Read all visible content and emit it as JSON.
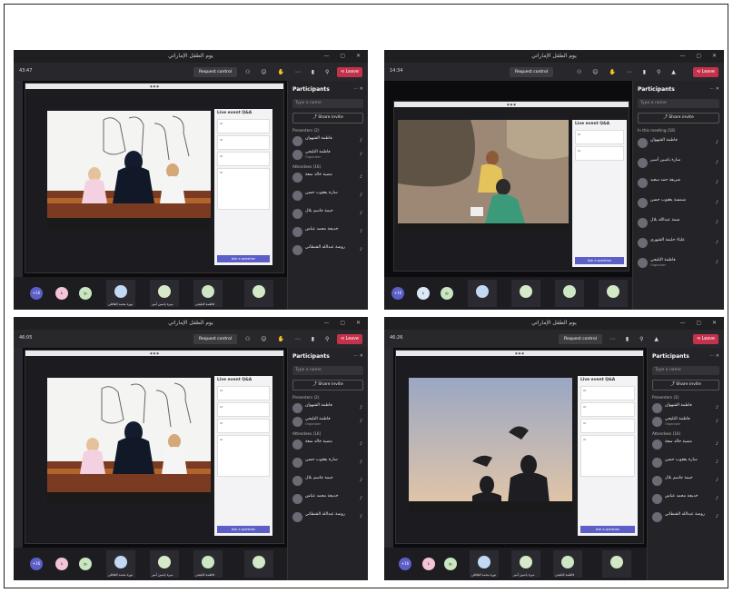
{
  "meeting_title": "يوم الطفل الإماراتي",
  "request_control": "Request control",
  "leave_label": "Leave",
  "participants_title": "Participants",
  "search_placeholder": "Type a name",
  "share_invite": "Share invite",
  "presenters": "Presenters (2)",
  "attendees": "Attendees (16)",
  "in_this_meeting": "In this meeting (18)",
  "organizer": "Organizer",
  "qa_title": "Live event Q&A",
  "ask_question": "Ask a question",
  "screens": [
    {
      "timer": "43:47",
      "scene": "kids"
    },
    {
      "timer": "14:34",
      "scene": "desert"
    },
    {
      "timer": "46:05",
      "scene": "kids"
    },
    {
      "timer": "46:26",
      "scene": "dusk"
    }
  ],
  "participants_a": [
    "فاطمة الشهوان",
    "فاطمة التليجي",
    "مضية خالد سعة",
    "سارة يعقوب حسن",
    "حيمة جاسم بلال",
    "خديجة محمد عباس",
    "روضة عبدالله الشطاني"
  ],
  "participants_b": [
    "فاطمة الشهوان",
    "سارة ياسين أسير",
    "شريفة حمد سعيد",
    "شمسة يعقوب حسن",
    "شمة عبدالله بلال",
    "علياء حليمة الشهري",
    "فاطمة التليجي"
  ],
  "tiles": [
    "+16",
    "نا",
    "نخ",
    "عبير الملا",
    "ليلى",
    "شيخة"
  ],
  "tile_labels": [
    "نورة محمد الغافلي",
    "ميرة ياسين أمير",
    "فاطمة التليجي"
  ],
  "colors": {
    "leave": "#c4314b",
    "accent": "#5b5fc7",
    "bg": "#141416"
  }
}
